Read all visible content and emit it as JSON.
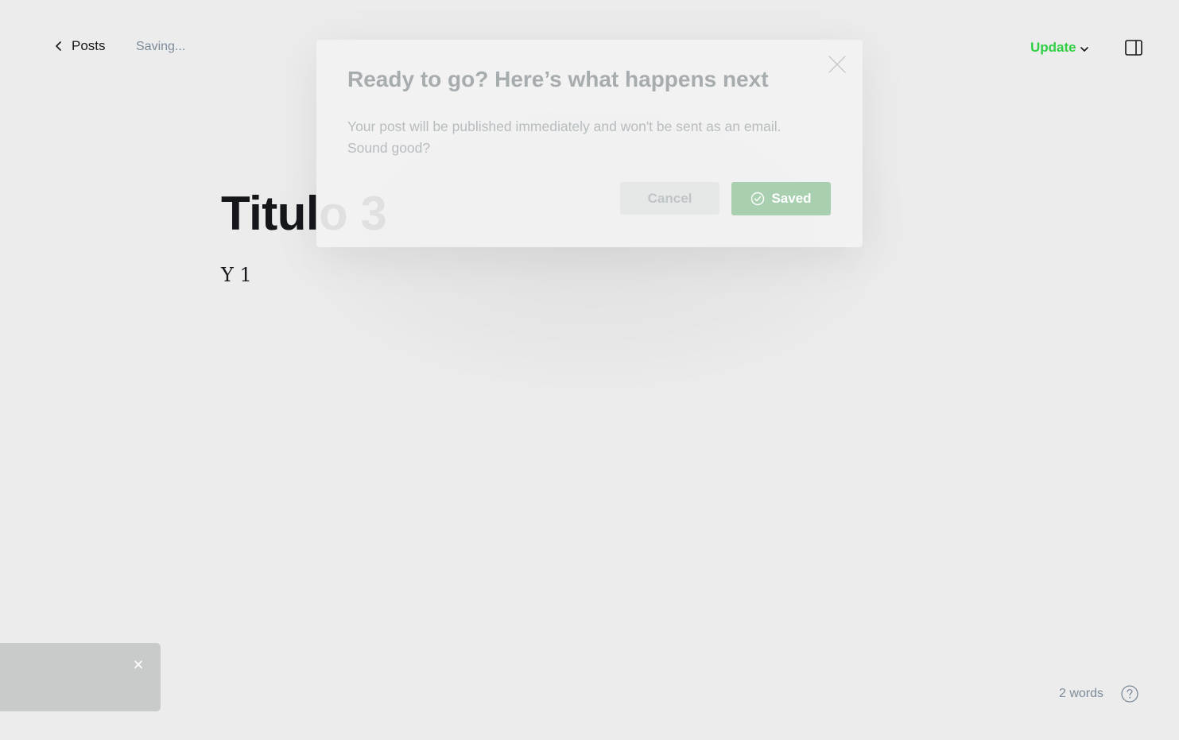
{
  "header": {
    "back_label": "Posts",
    "status": "Saving...",
    "update_label": "Update"
  },
  "editor": {
    "title": "Titulo 3",
    "body": "Y 1"
  },
  "modal": {
    "title": "Ready to go? Here’s what happens next",
    "text": "Your post will be published immediately and won't be sent as an email. Sound good?",
    "cancel_label": "Cancel",
    "confirm_label": "Saved"
  },
  "footer": {
    "word_count": "2 words"
  },
  "colors": {
    "accent_green": "#30cf43",
    "saved_button": "#a9cfb1",
    "background": "#ececec"
  },
  "icons": {
    "back": "chevron-left-icon",
    "update_dropdown": "chevron-down-icon",
    "sidebar": "sidebar-toggle-icon",
    "modal_close": "close-icon",
    "saved": "check-circle-icon",
    "toast_close": "close-icon",
    "help": "question-circle-icon"
  }
}
